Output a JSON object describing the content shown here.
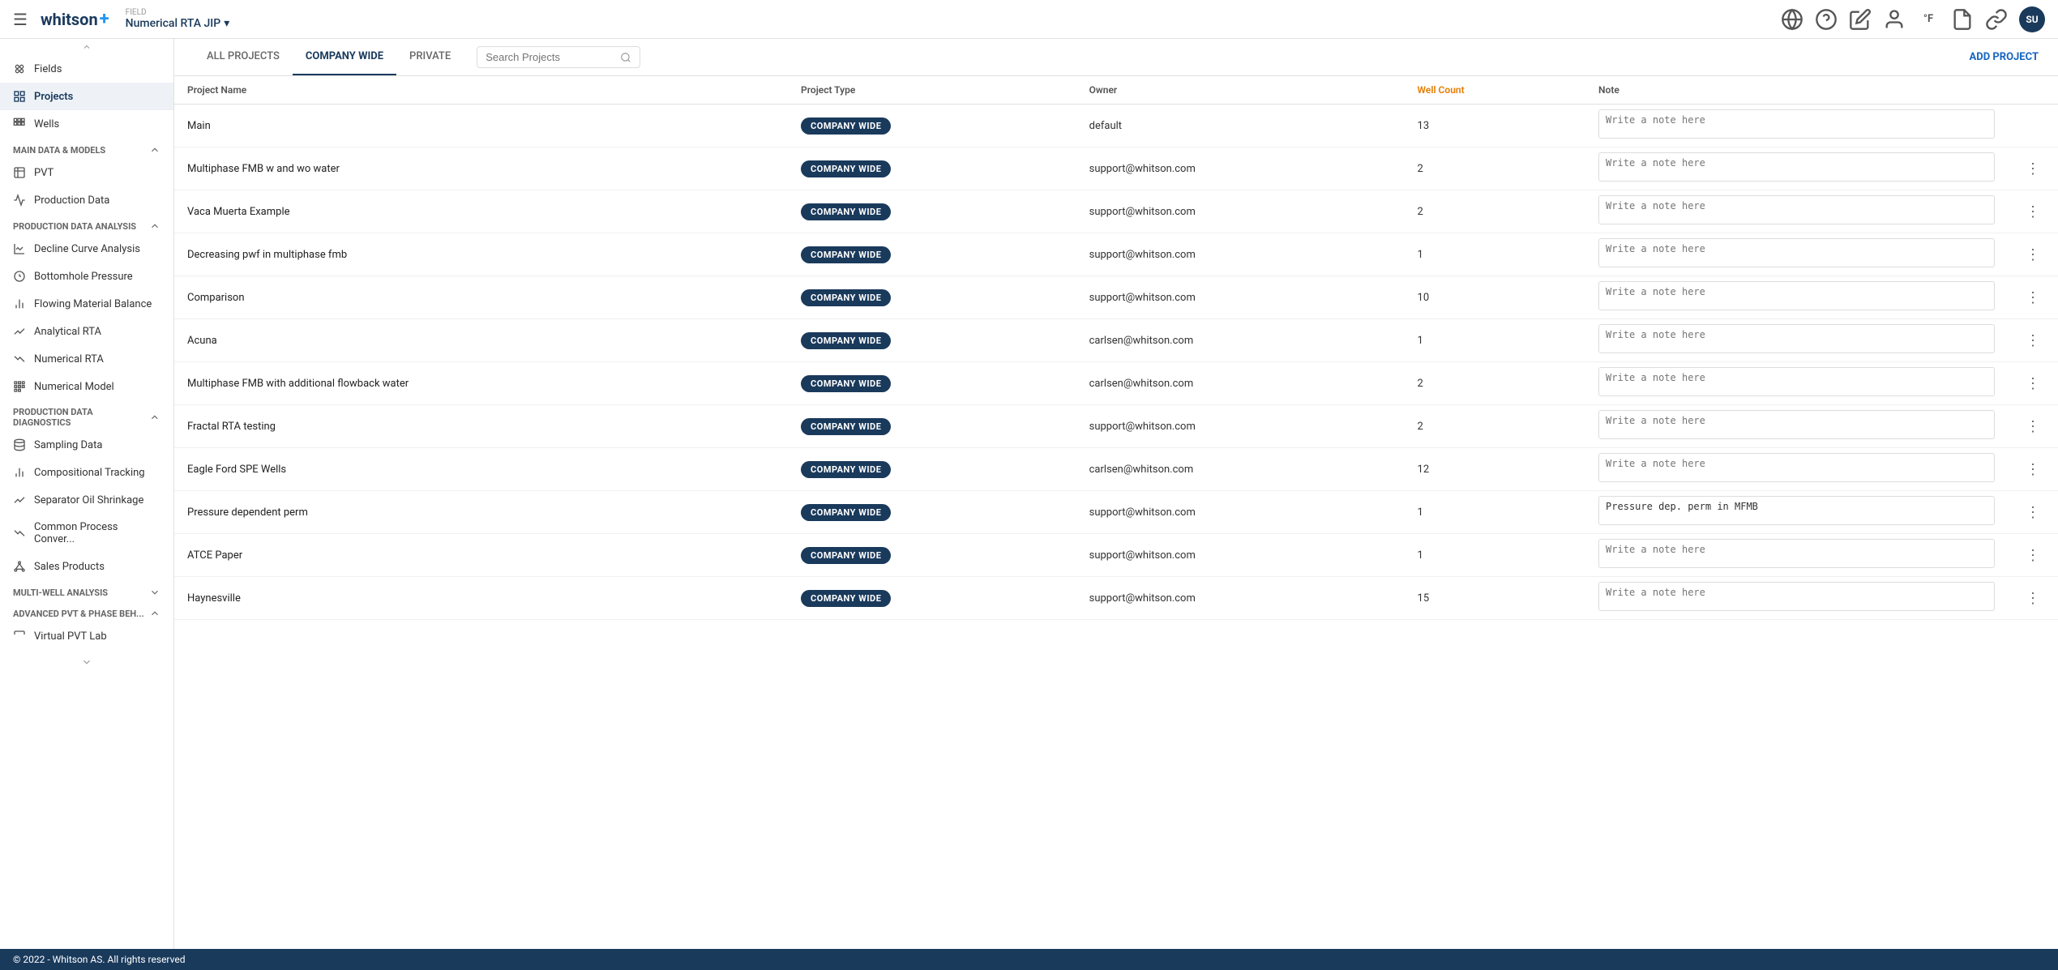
{
  "topbar": {
    "hamburger": "☰",
    "logo_text": "whitson",
    "logo_plus": "+",
    "field_label": "Field",
    "field_value": "Numerical RTA JIP",
    "dropdown_icon": "▾",
    "avatar_initials": "SU"
  },
  "sidebar": {
    "scroll_up": "▲",
    "items_top": [
      {
        "id": "fields",
        "label": "Fields",
        "icon": "share"
      },
      {
        "id": "projects",
        "label": "Projects",
        "icon": "folder",
        "active": true
      },
      {
        "id": "wells",
        "label": "Wells",
        "icon": "grid"
      }
    ],
    "sections": [
      {
        "id": "main-data-models",
        "label": "Main Data & Models",
        "expanded": true,
        "items": [
          {
            "id": "pvt",
            "label": "PVT",
            "icon": "flask"
          },
          {
            "id": "production-data",
            "label": "Production Data",
            "icon": "trend"
          }
        ]
      },
      {
        "id": "production-data-analysis",
        "label": "Production Data Analysis",
        "expanded": true,
        "items": [
          {
            "id": "decline-curve",
            "label": "Decline Curve Analysis",
            "icon": "curve"
          },
          {
            "id": "bottomhole-pressure",
            "label": "Bottomhole Pressure",
            "icon": "gauge"
          },
          {
            "id": "flowing-material",
            "label": "Flowing Material Balance",
            "icon": "chart-bar"
          },
          {
            "id": "analytical-rta",
            "label": "Analytical RTA",
            "icon": "line-up"
          },
          {
            "id": "numerical-rta",
            "label": "Numerical RTA",
            "icon": "line-down"
          },
          {
            "id": "numerical-model",
            "label": "Numerical Model",
            "icon": "grid-small"
          }
        ]
      },
      {
        "id": "production-data-diagnostics",
        "label": "Production Data Diagnostics",
        "expanded": true,
        "items": [
          {
            "id": "sampling-data",
            "label": "Sampling Data",
            "icon": "stack"
          },
          {
            "id": "compositional-tracking",
            "label": "Compositional Tracking",
            "icon": "bar-chart"
          },
          {
            "id": "separator-oil",
            "label": "Separator Oil Shrinkage",
            "icon": "line-diag"
          },
          {
            "id": "common-process",
            "label": "Common Process Conver...",
            "icon": "line-flat"
          },
          {
            "id": "sales-products",
            "label": "Sales Products",
            "icon": "network"
          }
        ]
      },
      {
        "id": "multi-well",
        "label": "Multi-well Analysis",
        "expanded": false,
        "items": []
      },
      {
        "id": "advanced-pvt",
        "label": "Advanced PVT & Phase Beh...",
        "expanded": true,
        "items": [
          {
            "id": "virtual-pvt-lab",
            "label": "Virtual PVT Lab",
            "icon": "flask2"
          }
        ]
      }
    ]
  },
  "tabs": {
    "items": [
      {
        "id": "all-projects",
        "label": "ALL PROJECTS",
        "active": false
      },
      {
        "id": "company-wide",
        "label": "COMPANY WIDE",
        "active": true
      },
      {
        "id": "private",
        "label": "PRIVATE",
        "active": false
      }
    ],
    "search_placeholder": "Search Projects",
    "add_button_label": "ADD PROJECT"
  },
  "table": {
    "columns": [
      {
        "id": "name",
        "label": "Project Name",
        "accent": false
      },
      {
        "id": "type",
        "label": "Project Type",
        "accent": false
      },
      {
        "id": "owner",
        "label": "Owner",
        "accent": false
      },
      {
        "id": "well_count",
        "label": "Well Count",
        "accent": true
      },
      {
        "id": "note",
        "label": "Note",
        "accent": false
      }
    ],
    "note_placeholder": "Write a note here",
    "badge_label": "COMPANY WIDE",
    "rows": [
      {
        "id": 1,
        "name": "Main",
        "type": "COMPANY WIDE",
        "owner": "default",
        "well_count": "13",
        "note": "",
        "has_menu": false
      },
      {
        "id": 2,
        "name": "Multiphase FMB w and wo water",
        "type": "COMPANY WIDE",
        "owner": "support@whitson.com",
        "well_count": "2",
        "note": "",
        "has_menu": true
      },
      {
        "id": 3,
        "name": "Vaca Muerta Example",
        "type": "COMPANY WIDE",
        "owner": "support@whitson.com",
        "well_count": "2",
        "note": "",
        "has_menu": true
      },
      {
        "id": 4,
        "name": "Decreasing pwf in multiphase fmb",
        "type": "COMPANY WIDE",
        "owner": "support@whitson.com",
        "well_count": "1",
        "note": "",
        "has_menu": true
      },
      {
        "id": 5,
        "name": "Comparison",
        "type": "COMPANY WIDE",
        "owner": "support@whitson.com",
        "well_count": "10",
        "note": "",
        "has_menu": true
      },
      {
        "id": 6,
        "name": "Acuna",
        "type": "COMPANY WIDE",
        "owner": "carlsen@whitson.com",
        "well_count": "1",
        "note": "",
        "has_menu": true
      },
      {
        "id": 7,
        "name": "Multiphase FMB with additional flowback water",
        "type": "COMPANY WIDE",
        "owner": "carlsen@whitson.com",
        "well_count": "2",
        "note": "",
        "has_menu": true
      },
      {
        "id": 8,
        "name": "Fractal RTA testing",
        "type": "COMPANY WIDE",
        "owner": "support@whitson.com",
        "well_count": "2",
        "note": "",
        "has_menu": true
      },
      {
        "id": 9,
        "name": "Eagle Ford SPE Wells",
        "type": "COMPANY WIDE",
        "owner": "carlsen@whitson.com",
        "well_count": "12",
        "note": "",
        "has_menu": true
      },
      {
        "id": 10,
        "name": "Pressure dependent perm",
        "type": "COMPANY WIDE",
        "owner": "support@whitson.com",
        "well_count": "1",
        "note": "Pressure dep. perm in MFMB",
        "has_menu": true
      },
      {
        "id": 11,
        "name": "ATCE Paper",
        "type": "COMPANY WIDE",
        "owner": "support@whitson.com",
        "well_count": "1",
        "note": "",
        "has_menu": true
      },
      {
        "id": 12,
        "name": "Haynesville",
        "type": "COMPANY WIDE",
        "owner": "support@whitson.com",
        "well_count": "15",
        "note": "",
        "has_menu": true
      }
    ]
  },
  "footer": {
    "text": "© 2022 - Whitson AS. All rights reserved"
  },
  "icons": {
    "search": "🔍",
    "globe": "🌐",
    "question": "❓",
    "edit": "✏️",
    "person": "👤",
    "temp": "°F",
    "doc": "📄",
    "link": "🔗",
    "chevron_down": "▾",
    "chevron_up": "▴",
    "dots_vertical": "⋮",
    "scroll_down": "▾"
  }
}
